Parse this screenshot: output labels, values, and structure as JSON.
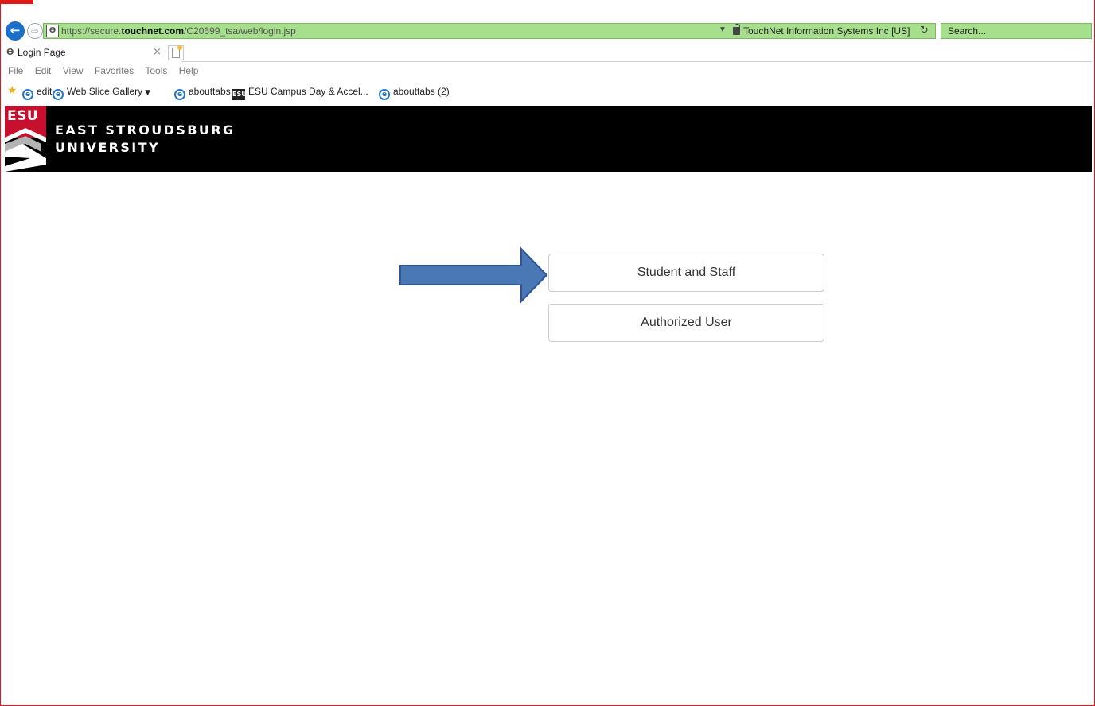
{
  "browser": {
    "url_prefix": "https://secure.",
    "url_domain": "touchnet.com",
    "url_path": "/C20699_tsa/web/login.jsp",
    "cert_label": "TouchNet Information Systems Inc [US]",
    "search_placeholder": "Search...",
    "tab_title": "Login Page",
    "menu": [
      "File",
      "Edit",
      "View",
      "Favorites",
      "Tools",
      "Help"
    ],
    "favorites": [
      "edit",
      "Web Slice Gallery",
      "abouttabs",
      "ESU Campus Day & Accel...",
      "abouttabs (2)"
    ],
    "accent_color": "#a7e08c"
  },
  "header": {
    "logo_text": "ESU",
    "brand_line1": "EAST STROUDSBURG",
    "brand_line2": "UNIVERSITY"
  },
  "login": {
    "student_staff_label": "Student and Staff",
    "authorized_user_label": "Authorized User"
  },
  "annotation": {
    "arrow_color": "#4a78b4"
  }
}
